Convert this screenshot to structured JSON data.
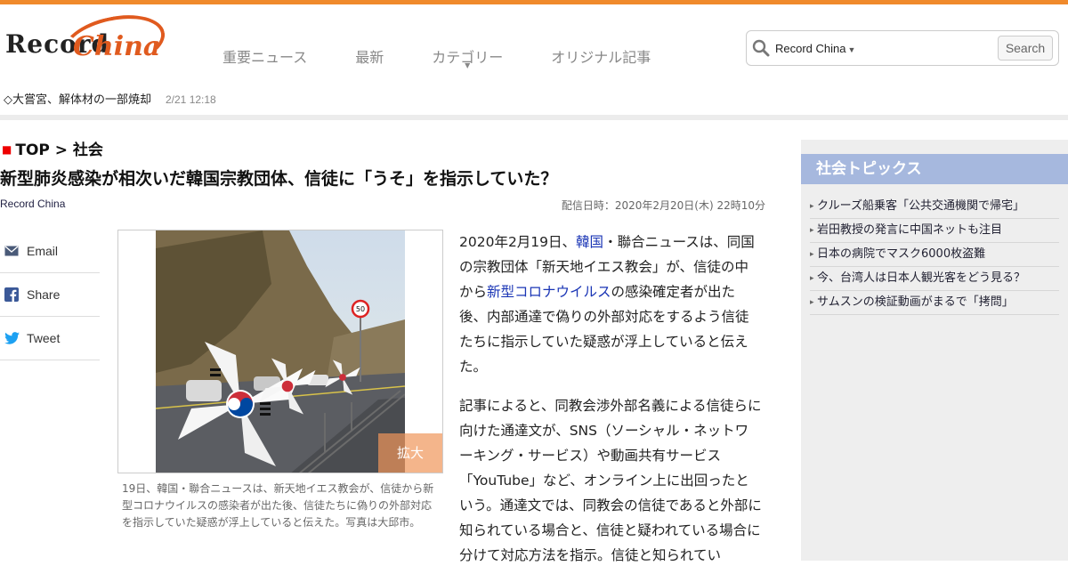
{
  "colors": {
    "top_bar": "#f08a2c",
    "brand_orange": "#e05a1e",
    "side_header": "#a6b8de",
    "link": "#1a35b5",
    "crumb_marker": "#ee0000"
  },
  "header": {
    "logo_text_1": "Record",
    "logo_text_2": "China",
    "nav": [
      {
        "label": "重要ニュース"
      },
      {
        "label": "最新"
      },
      {
        "label": "カテゴリー",
        "has_dropdown": true
      },
      {
        "label": "オリジナル記事"
      }
    ],
    "search": {
      "scope": "Record China",
      "value": "",
      "button": "Search",
      "icon": "search-icon"
    },
    "ticker": {
      "text": "◇大嘗宮、解体材の一部焼却",
      "time": "2/21 12:18"
    }
  },
  "article": {
    "breadcrumb": "TOP > 社会",
    "title": "新型肺炎感染が相次いだ韓国宗教団体、信徒に「うそ」を指示していた？",
    "source": "Record China",
    "date": "配信日時：2020年2月20日(木) 22時10分",
    "share": [
      {
        "label": "Email",
        "icon": "email-icon"
      },
      {
        "label": "Share",
        "icon": "facebook-icon"
      },
      {
        "label": "Tweet",
        "icon": "twitter-icon"
      }
    ],
    "photo": {
      "zoom_label": "拡大",
      "sign_number": "50"
    },
    "caption": "19日、韓国・聯合ニュースは、新天地イエス教会が、信徒から新型コロナウイルスの感染者が出た後、信徒たちに偽りの外部対応を指示していた疑惑が浮上していると伝えた。写真は大邱市。",
    "p1": {
      "a": "2020年2月19日、",
      "link1": "韓国",
      "b": "・聯合ニュースは、同国の宗教団体「新天地イエス教会」が、信徒の中から",
      "link2": "新型コロナウイルス",
      "c": "の感染確定者が出た後、内部通達で偽りの外部対応をするよう信徒たちに指示していた疑惑が浮上していると伝えた。"
    },
    "p2": "記事によると、同教会渉外部名義による信徒らに向けた通達文が、SNS（ソーシャル・ネットワーキング・サービス）や動画共有サービス「YouTube」など、オンライン上に出回ったという。通達文では、同教会の信徒であると外部に知られている場合と、信徒と疑われている場合に分けて対応方法を指示。信徒と知られてい"
  },
  "sidebar": {
    "title": "社会トピックス",
    "items": [
      {
        "label": "クルーズ船乗客「公共交通機関で帰宅」"
      },
      {
        "label": "岩田教授の発言に中国ネットも注目"
      },
      {
        "label": "日本の病院でマスク6000枚盗難"
      },
      {
        "label": "今、台湾人は日本人観光客をどう見る？"
      },
      {
        "label": "サムスンの検証動画がまるで「拷問」"
      }
    ]
  }
}
